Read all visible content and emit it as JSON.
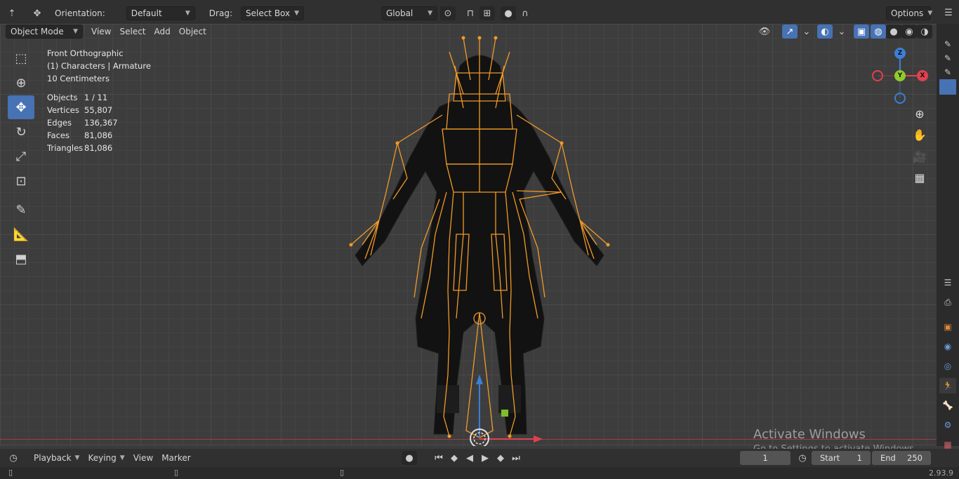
{
  "header": {
    "orientation_label": "Orientation:",
    "orientation_value": "Default",
    "drag_label": "Drag:",
    "drag_value": "Select Box",
    "transform_space": "Global",
    "options": "Options"
  },
  "menubar": {
    "mode": "Object Mode",
    "items": [
      "View",
      "Select",
      "Add",
      "Object"
    ]
  },
  "overlay": {
    "view_name": "Front Orthographic",
    "collection": "(1) Characters | Armature",
    "scale": "10 Centimeters"
  },
  "stats": [
    {
      "key": "Objects",
      "value": "1 / 11"
    },
    {
      "key": "Vertices",
      "value": "55,807"
    },
    {
      "key": "Edges",
      "value": "136,367"
    },
    {
      "key": "Faces",
      "value": "81,086"
    },
    {
      "key": "Triangles",
      "value": "81,086"
    }
  ],
  "gizmo": {
    "z": "Z",
    "y": "Y",
    "x": "X",
    "colors": {
      "x": "#e0414f",
      "y": "#8fcb2a",
      "z": "#3b7fd6"
    }
  },
  "tools": [
    "select-box-icon",
    "cursor-icon",
    "move-icon",
    "rotate-icon",
    "scale-icon",
    "transform-icon",
    "annotate-icon",
    "measure-icon",
    "add-cube-icon"
  ],
  "timeline": {
    "playback": "Playback",
    "keying": "Keying",
    "view": "View",
    "marker": "Marker",
    "current_frame": "1",
    "start_label": "Start",
    "start_value": "1",
    "end_label": "End",
    "end_value": "250"
  },
  "status": {
    "version": "2.93.9"
  },
  "watermark": {
    "line1": "Activate Windows",
    "line2": "Go to Settings to activate Windows."
  },
  "colors": {
    "accent": "#4772b3",
    "armature": "#f29a26",
    "mesh": "#111111"
  }
}
